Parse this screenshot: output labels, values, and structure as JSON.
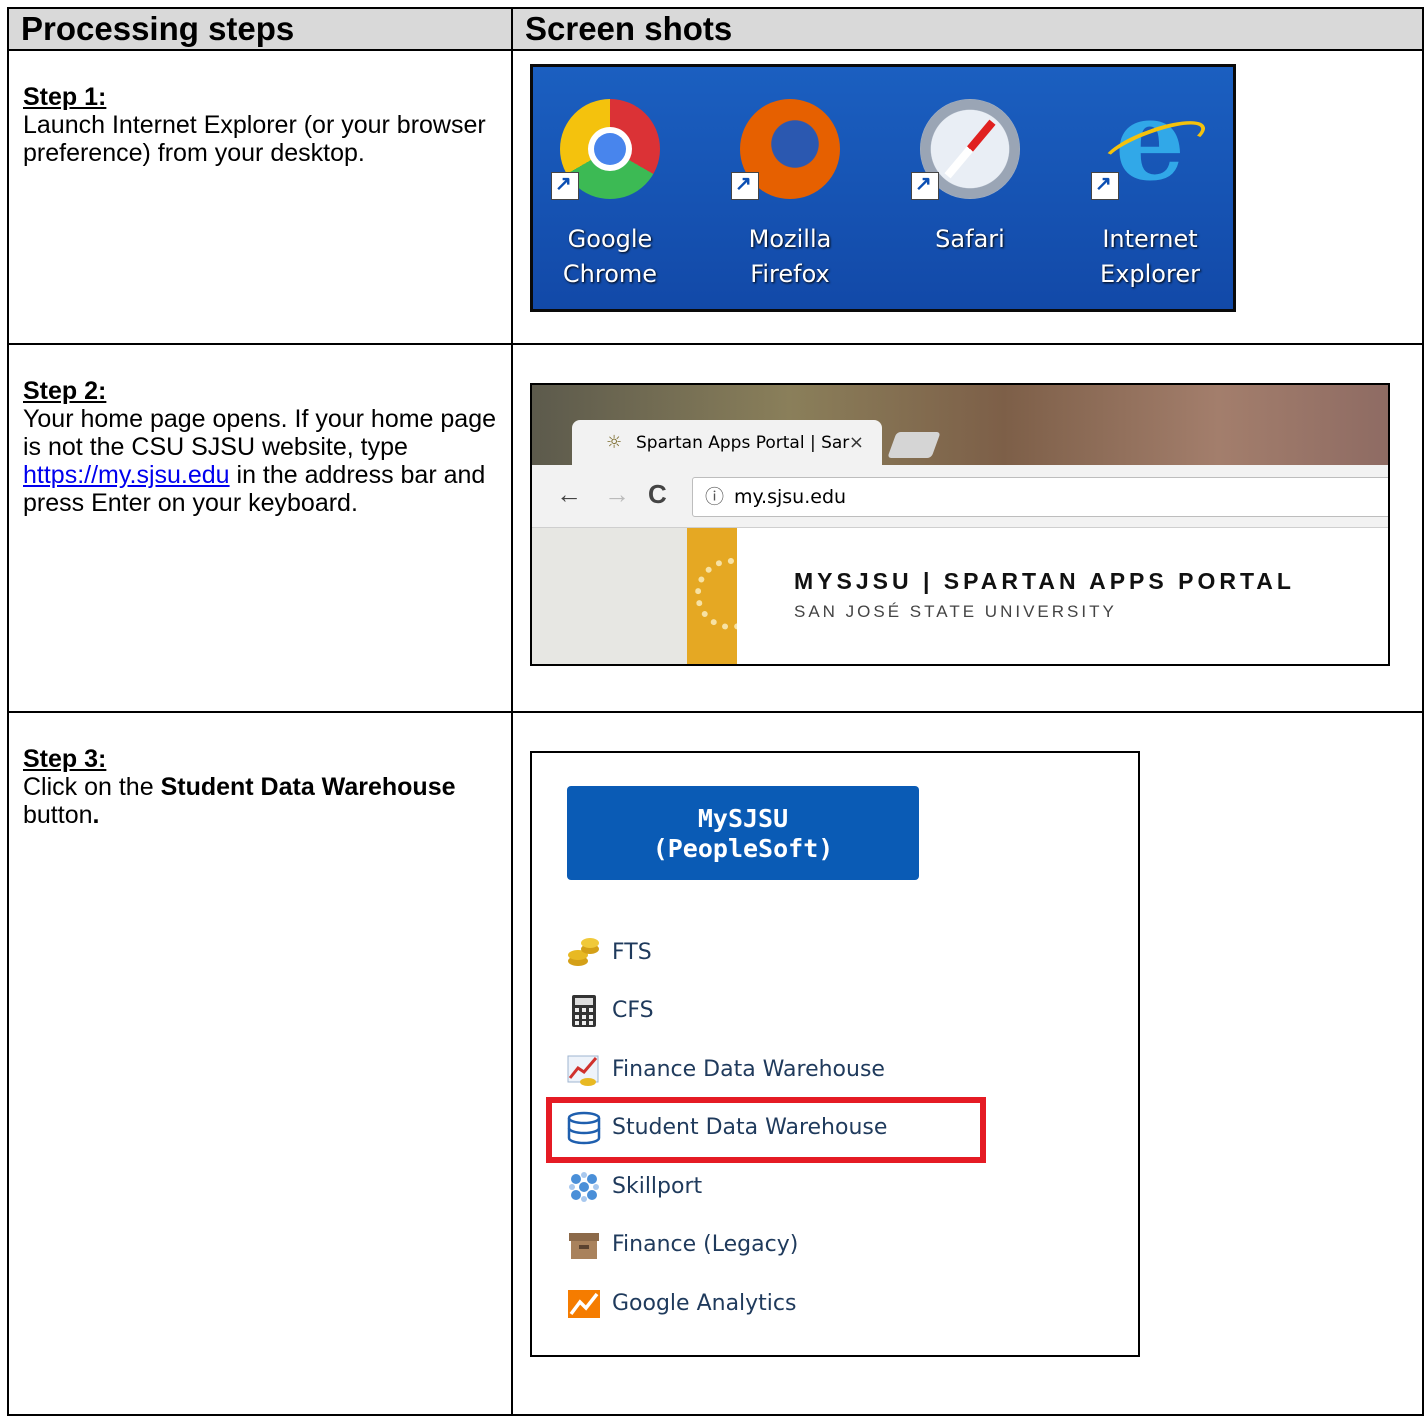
{
  "header": {
    "col1": "Processing steps",
    "col2": "Screen shots"
  },
  "steps": [
    {
      "title": "Step 1:",
      "text": "Launch Internet Explorer (or your browser preference) from your desktop."
    },
    {
      "title": "Step 2:",
      "text_before": "Your home page opens. If your home page is not the CSU SJSU website, type ",
      "link": "https://my.sjsu.edu",
      "text_after": " in the address bar and press Enter on your keyboard."
    },
    {
      "title": "Step 3:",
      "text_before": "Click on the ",
      "bold": "Student Data Warehouse",
      "text_after": " button",
      "period": "."
    }
  ],
  "desktop_icons": [
    {
      "line1": "Google",
      "line2": "Chrome",
      "icon": "chrome-icon"
    },
    {
      "line1": "Mozilla",
      "line2": "Firefox",
      "icon": "firefox-icon"
    },
    {
      "line1": "Safari",
      "line2": "",
      "icon": "safari-icon"
    },
    {
      "line1": "Internet",
      "line2": "Explorer",
      "icon": "ie-icon"
    }
  ],
  "browser": {
    "tab_title": "Spartan Apps Portal | Sar",
    "tab_close": "×",
    "back": "←",
    "forward": "→",
    "reload": "C",
    "info": "ⓘ",
    "url": "my.sjsu.edu",
    "portal_title": "MYSJSU | SPARTAN APPS PORTAL",
    "portal_subtitle": "SAN JOSÉ STATE UNIVERSITY"
  },
  "portal": {
    "button_line1": "MySJSU",
    "button_line2": "(PeopleSoft)",
    "items": [
      {
        "label": "FTS",
        "icon": "coins-icon"
      },
      {
        "label": "CFS",
        "icon": "calculator-icon"
      },
      {
        "label": "Finance Data Warehouse",
        "icon": "chart-coins-icon"
      },
      {
        "label": "Student Data Warehouse",
        "icon": "database-icon"
      },
      {
        "label": "Skillport",
        "icon": "skillport-icon"
      },
      {
        "label": "Finance (Legacy)",
        "icon": "archive-box-icon"
      },
      {
        "label": "Google Analytics",
        "icon": "analytics-icon"
      }
    ],
    "highlight_color": "#e51b24",
    "button_color": "#0a5bb5"
  }
}
